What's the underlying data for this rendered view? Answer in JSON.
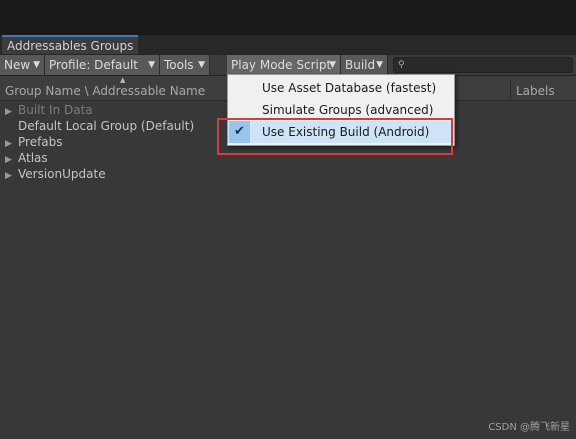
{
  "window": {
    "tab_title": "Addressables Groups"
  },
  "toolbar": {
    "new_label": "New",
    "profile_label": "Profile: Default",
    "tools_label": "Tools",
    "play_mode_label": "Play Mode Script",
    "build_label": "Build",
    "search_value": ""
  },
  "header": {
    "group_name": "Group Name \\ Addressable Name",
    "labels": "Labels"
  },
  "tree": [
    {
      "label": "Built In Data",
      "has_arrow": true,
      "dim": true
    },
    {
      "label": "Default Local Group (Default)",
      "has_arrow": false,
      "dim": false
    },
    {
      "label": "Prefabs",
      "has_arrow": true,
      "dim": false
    },
    {
      "label": "Atlas",
      "has_arrow": true,
      "dim": false
    },
    {
      "label": "VersionUpdate",
      "has_arrow": true,
      "dim": false
    }
  ],
  "dropdown": {
    "items": [
      {
        "label": "Use Asset Database (fastest)",
        "checked": false
      },
      {
        "label": "Simulate Groups (advanced)",
        "checked": false
      },
      {
        "label": "Use Existing Build (Android)",
        "checked": true
      }
    ]
  },
  "watermark": "CSDN @腾飞新星",
  "colors": {
    "accent_tab": "#3a79bb",
    "highlight_box": "#d9393f",
    "menu_selected": "#cfe3f7"
  }
}
